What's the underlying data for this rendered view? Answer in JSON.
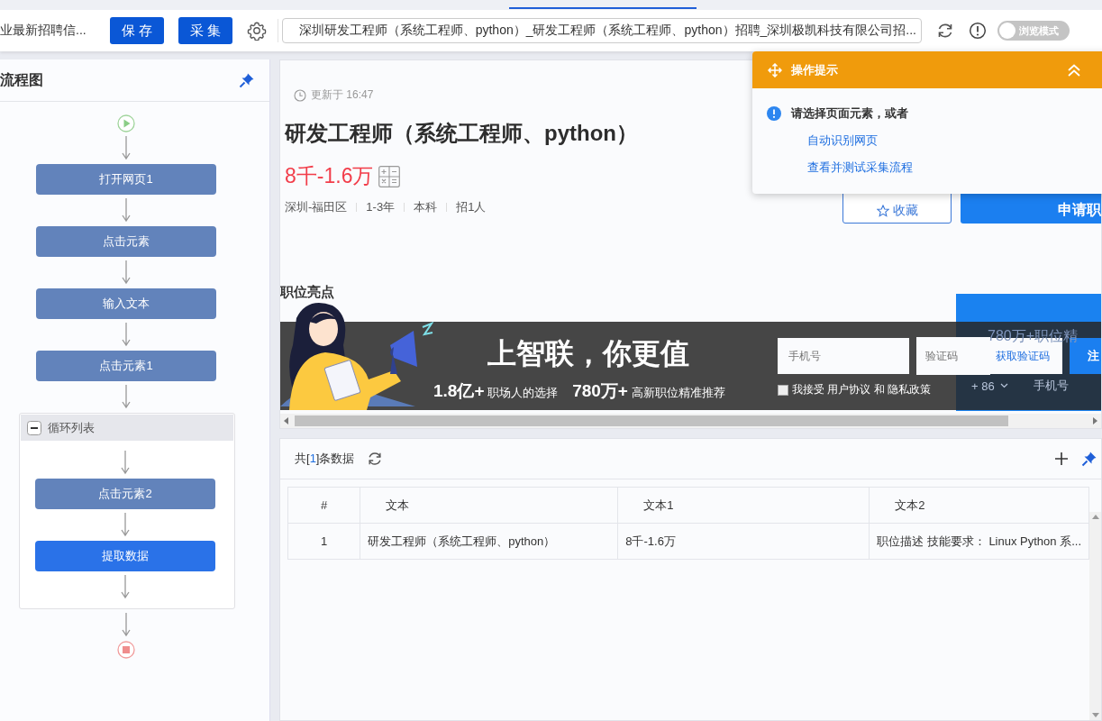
{
  "toolbar": {
    "page_title": "业最新招聘信...",
    "buttons": [
      "保 存",
      "采 集"
    ],
    "url": "深圳研发工程师（系统工程师、python）_研发工程师（系统工程师、python）招聘_深圳极凯科技有限公司招...",
    "browse_mode": {
      "label": "浏览模式",
      "on": false
    }
  },
  "flow_panel": {
    "title": "流程图",
    "nodes": [
      {
        "kind": "start"
      },
      {
        "kind": "action",
        "label": "打开网页1",
        "selected": false
      },
      {
        "kind": "action",
        "label": "点击元素",
        "selected": false
      },
      {
        "kind": "action",
        "label": "输入文本",
        "selected": false
      },
      {
        "kind": "action",
        "label": "点击元素1",
        "selected": false
      },
      {
        "kind": "loop",
        "label": "循环列表",
        "expanded": true,
        "children": [
          {
            "kind": "action",
            "label": "点击元素2",
            "selected": false
          },
          {
            "kind": "action",
            "label": "提取数据",
            "selected": true
          }
        ]
      },
      {
        "kind": "end"
      }
    ]
  },
  "page": {
    "updated": "更新于 16:47",
    "job_title": "研发工程师（系统工程师、python）",
    "salary": "8千-1.6万",
    "tags": [
      "深圳-福田区",
      "1-3年",
      "本科",
      "招1人"
    ],
    "save_button": "收藏",
    "apply_button": "申请职",
    "highlights_title": "职位亮点"
  },
  "banner": {
    "headline": "上智联，你更值",
    "stats": [
      {
        "number": "1.8亿+",
        "text": "职场人的选择"
      },
      {
        "number": "780万+",
        "text": "高新职位精准推荐"
      }
    ],
    "phone_placeholder": "手机号",
    "code_placeholder": "验证码",
    "code_link": "获取验证码",
    "register_button": "注",
    "agree": {
      "checked": false,
      "text": "我接受 用户协议 和 隐私政策"
    },
    "side_panel": {
      "title": "780万+职位精",
      "country_code": "+ 86",
      "phone_placeholder": "手机号"
    }
  },
  "data_panel": {
    "count_prefix": "共[",
    "count": "1",
    "count_suffix": "]条数据",
    "columns": [
      "#",
      "文本",
      "文本1",
      "文本2"
    ],
    "rows": [
      [
        "1",
        "研发工程师（系统工程师、python）",
        "8千-1.6万",
        "职位描述 技能要求：  Linux Python 系..."
      ]
    ]
  },
  "tip": {
    "title": "操作提示",
    "message": "请选择页面元素，或者",
    "links": [
      "自动识别网页",
      "查看并测试采集流程"
    ]
  }
}
